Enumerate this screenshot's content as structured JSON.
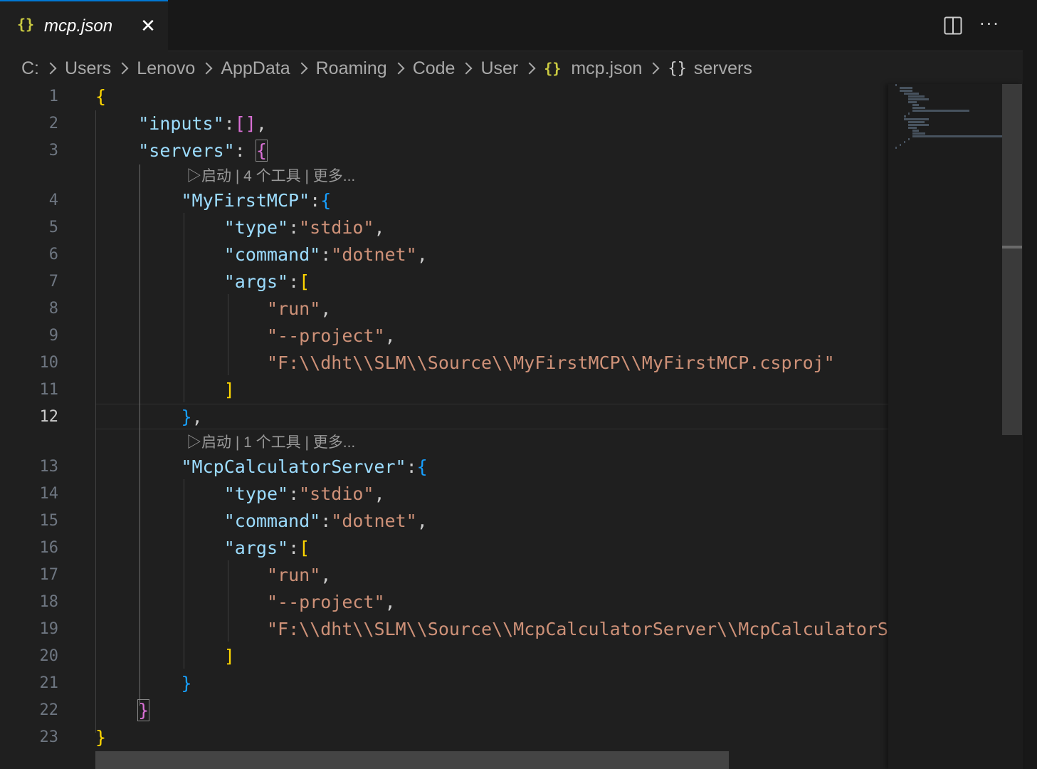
{
  "tab": {
    "icon": "{}",
    "title": "mcp.json",
    "close_label": "✕"
  },
  "toolbar": {
    "split_icon": "split-editor-icon",
    "more_label": "···"
  },
  "breadcrumb": {
    "segments": [
      "C:",
      "Users",
      "Lenovo",
      "AppData",
      "Roaming",
      "Code",
      "User"
    ],
    "file_icon": "{}",
    "file": "mcp.json",
    "symbol_icon": "{}",
    "symbol": "servers"
  },
  "editor": {
    "line_numbers": [
      "1",
      "2",
      "3",
      "4",
      "5",
      "6",
      "7",
      "8",
      "9",
      "10",
      "11",
      "12",
      "13",
      "14",
      "15",
      "16",
      "17",
      "18",
      "19",
      "20",
      "21",
      "22",
      "23"
    ],
    "active_line": "12",
    "codelens": [
      "▷启动 | 4 个工具 | 更多...",
      "▷启动 | 1 个工具 | 更多..."
    ],
    "lines": [
      "{",
      "    \"inputs\":[],",
      "    \"servers\": {",
      "        \"MyFirstMCP\":{",
      "            \"type\":\"stdio\",",
      "            \"command\":\"dotnet\",",
      "            \"args\":[",
      "                \"run\",",
      "                \"--project\",",
      "                \"F:\\\\dht\\\\SLM\\\\Source\\\\MyFirstMCP\\\\MyFirstMCP.csproj\"",
      "            ]",
      "        },",
      "        \"McpCalculatorServer\":{",
      "            \"type\":\"stdio\",",
      "            \"command\":\"dotnet\",",
      "            \"args\":[",
      "                \"run\",",
      "                \"--project\",",
      "                \"F:\\\\dht\\\\SLM\\\\Source\\\\McpCalculatorServer\\\\McpCalculatorServer\\\\McpCalculatorServer.csproj\"",
      "            ]",
      "        }",
      "    }",
      "}"
    ]
  },
  "colors": {
    "key": "#9cdcfe",
    "string": "#ce9178",
    "bracket1": "#ffd700",
    "bracket2": "#da70d6",
    "bracket3": "#179fff",
    "accent": "#0078d4"
  }
}
